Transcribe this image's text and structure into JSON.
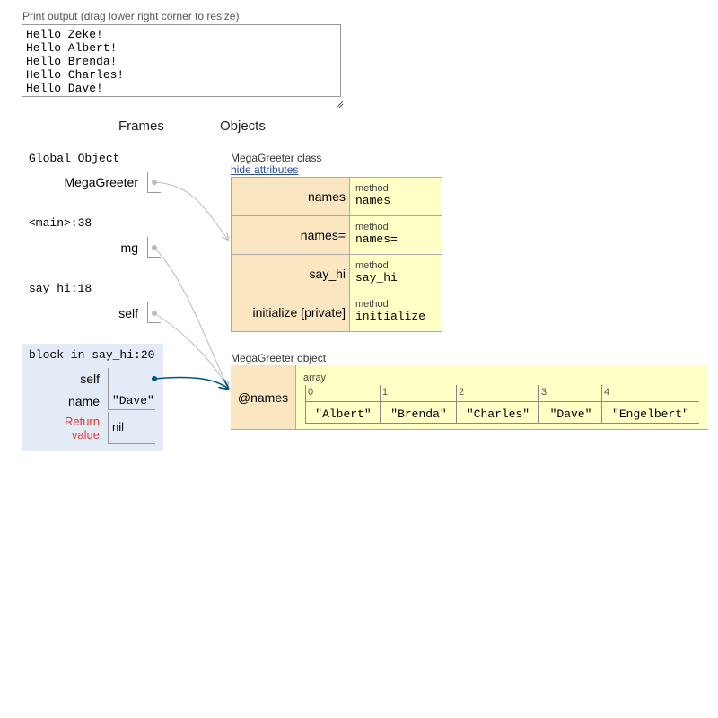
{
  "print": {
    "label": "Print output (drag lower right corner to resize)",
    "lines": [
      "Hello Zeke!",
      "Hello Albert!",
      "Hello Brenda!",
      "Hello Charles!",
      "Hello Dave!"
    ]
  },
  "headers": {
    "frames": "Frames",
    "objects": "Objects"
  },
  "frames": {
    "global": {
      "title": "Global Object",
      "var": "MegaGreeter"
    },
    "main": {
      "title": "<main>:38",
      "var": "mg"
    },
    "say_hi": {
      "title": "say_hi:18",
      "var": "self"
    },
    "block": {
      "title": "block in say_hi:20",
      "self_label": "self",
      "name_label": "name",
      "name_value": "\"Dave\"",
      "return_label_1": "Return",
      "return_label_2": "value",
      "return_value": "nil"
    }
  },
  "class_obj": {
    "label": "MegaGreeter class",
    "hide_link": "hide attributes",
    "rows": [
      {
        "key": "names",
        "type": "method",
        "value": "names"
      },
      {
        "key": "names=",
        "type": "method",
        "value": "names="
      },
      {
        "key": "say_hi",
        "type": "method",
        "value": "say_hi"
      },
      {
        "key": "initialize [private]",
        "type": "method",
        "value": "initialize"
      }
    ]
  },
  "instance_obj": {
    "label": "MegaGreeter object",
    "key": "@names",
    "array_type": "array",
    "items": [
      {
        "index": "0",
        "value": "\"Albert\""
      },
      {
        "index": "1",
        "value": "\"Brenda\""
      },
      {
        "index": "2",
        "value": "\"Charles\""
      },
      {
        "index": "3",
        "value": "\"Dave\""
      },
      {
        "index": "4",
        "value": "\"Engelbert\""
      }
    ]
  },
  "colors": {
    "pointer_active": "#005583",
    "pointer_inactive": "#bbbbbb",
    "return_red": "#ee3333"
  }
}
